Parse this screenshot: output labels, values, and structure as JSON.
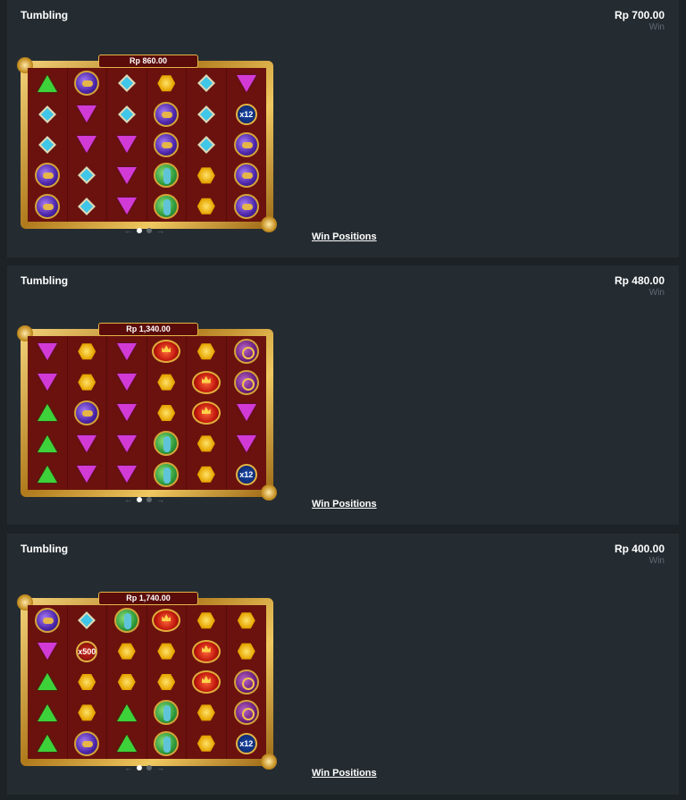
{
  "pager": {
    "prev_arrow": "←",
    "next_arrow": "→"
  },
  "rounds": [
    {
      "title": "Tumbling",
      "amount": "Rp 700.00",
      "win_label": "Win",
      "balance": "Rp 860.00",
      "win_positions_label": "Win Positions",
      "grid": [
        [
          "green-triangle",
          "purple-orb",
          "blue-diamond",
          "yellow-hex",
          "blue-diamond",
          "pink-triangle"
        ],
        [
          "blue-diamond",
          "pink-triangle",
          "blue-diamond",
          "purple-orb",
          "blue-diamond",
          "multiplier:x12"
        ],
        [
          "blue-diamond",
          "pink-triangle",
          "pink-triangle",
          "purple-orb",
          "blue-diamond",
          "purple-orb"
        ],
        [
          "purple-orb",
          "blue-diamond",
          "pink-triangle",
          "green-orb",
          "yellow-hex",
          "purple-orb"
        ],
        [
          "purple-orb",
          "blue-diamond",
          "pink-triangle",
          "green-orb",
          "yellow-hex",
          "purple-orb"
        ]
      ]
    },
    {
      "title": "Tumbling",
      "amount": "Rp 480.00",
      "win_label": "Win",
      "balance": "Rp 1,340.00",
      "win_positions_label": "Win Positions",
      "grid": [
        [
          "pink-triangle",
          "yellow-hex",
          "pink-triangle",
          "red-crown",
          "yellow-hex",
          "ring-orb"
        ],
        [
          "pink-triangle",
          "yellow-hex",
          "pink-triangle",
          "yellow-hex",
          "red-crown",
          "ring-orb"
        ],
        [
          "green-triangle",
          "purple-orb",
          "pink-triangle",
          "yellow-hex",
          "red-crown",
          "pink-triangle"
        ],
        [
          "green-triangle",
          "pink-triangle",
          "pink-triangle",
          "green-orb",
          "yellow-hex",
          "pink-triangle"
        ],
        [
          "green-triangle",
          "pink-triangle",
          "pink-triangle",
          "green-orb",
          "yellow-hex",
          "multiplier:x12"
        ]
      ]
    },
    {
      "title": "Tumbling",
      "amount": "Rp 400.00",
      "win_label": "Win",
      "balance": "Rp 1,740.00",
      "win_positions_label": "Win Positions",
      "grid": [
        [
          "purple-orb",
          "blue-diamond",
          "green-orb",
          "red-crown",
          "yellow-hex",
          "yellow-hex"
        ],
        [
          "pink-triangle",
          "multiplier-red:x500",
          "yellow-hex",
          "yellow-hex",
          "red-crown",
          "yellow-hex"
        ],
        [
          "green-triangle",
          "yellow-hex",
          "yellow-hex",
          "yellow-hex",
          "red-crown",
          "ring-orb"
        ],
        [
          "green-triangle",
          "yellow-hex",
          "green-triangle",
          "green-orb",
          "yellow-hex",
          "ring-orb"
        ],
        [
          "green-triangle",
          "purple-orb",
          "green-triangle",
          "green-orb",
          "yellow-hex",
          "multiplier:x12"
        ]
      ]
    }
  ]
}
